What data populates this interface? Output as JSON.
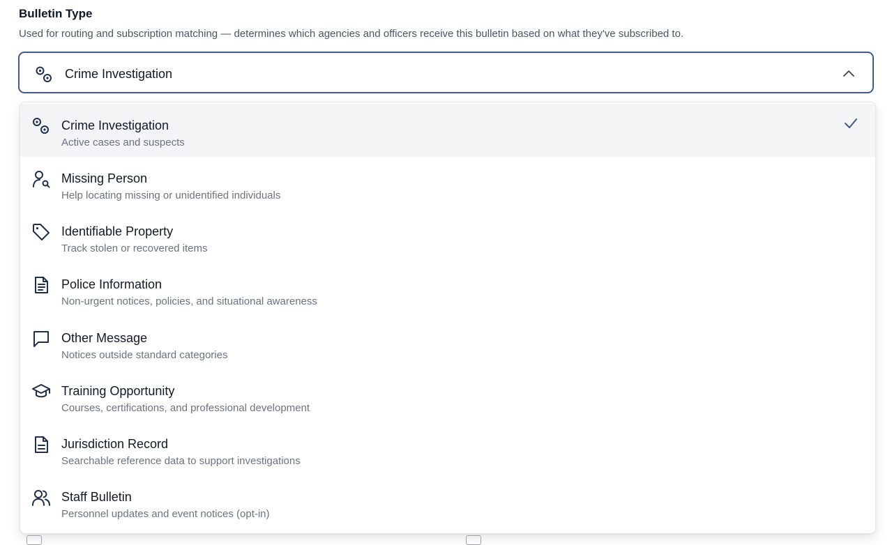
{
  "field": {
    "label": "Bulletin Type",
    "help": "Used for routing and subscription matching — determines which agencies and officers receive this bulletin based on what they've subscribed to.",
    "selected_value": "Crime Investigation",
    "selected_icon": "crime-investigation-icon",
    "expanded": true
  },
  "options": [
    {
      "label": "Crime Investigation",
      "description": "Active cases and suspects",
      "icon": "crime-investigation-icon",
      "selected": true
    },
    {
      "label": "Missing Person",
      "description": "Help locating missing or unidentified individuals",
      "icon": "person-search-icon",
      "selected": false
    },
    {
      "label": "Identifiable Property",
      "description": "Track stolen or recovered items",
      "icon": "tag-icon",
      "selected": false
    },
    {
      "label": "Police Information",
      "description": "Non-urgent notices, policies, and situational awareness",
      "icon": "document-icon",
      "selected": false
    },
    {
      "label": "Other Message",
      "description": "Notices outside standard categories",
      "icon": "message-icon",
      "selected": false
    },
    {
      "label": "Training Opportunity",
      "description": "Courses, certifications, and professional development",
      "icon": "graduation-cap-icon",
      "selected": false
    },
    {
      "label": "Jurisdiction Record",
      "description": "Searchable reference data to support investigations",
      "icon": "record-icon",
      "selected": false
    },
    {
      "label": "Staff Bulletin",
      "description": "Personnel updates and event notices (opt-in)",
      "icon": "users-icon",
      "selected": false
    }
  ],
  "colors": {
    "accent": "#3e5c86",
    "icon": "#1e2f4d",
    "selected_row": "#f3f4f6",
    "muted_text": "#6b7280"
  }
}
